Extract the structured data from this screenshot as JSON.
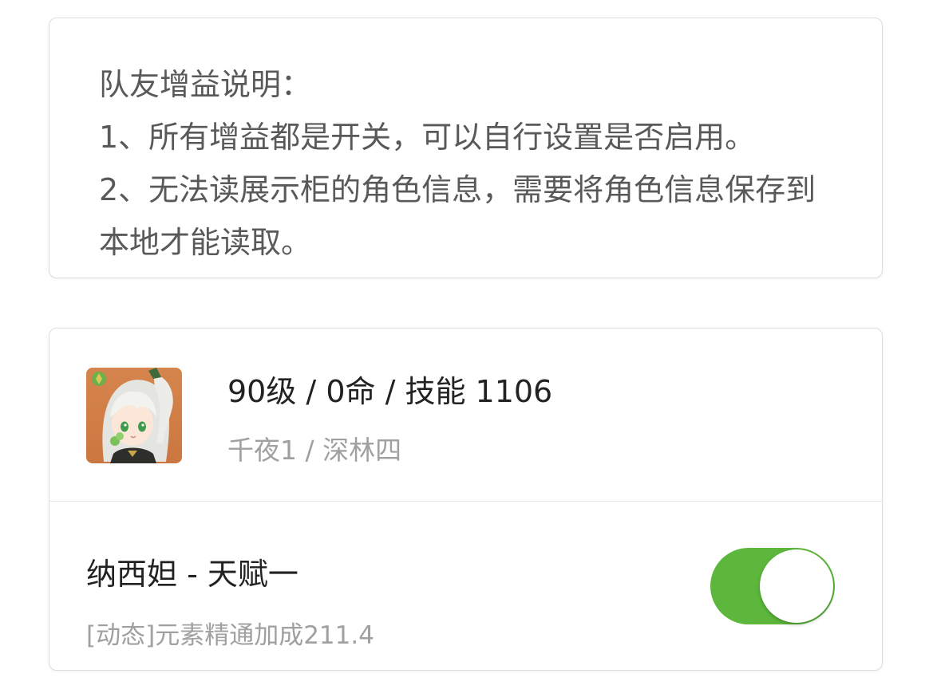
{
  "info": {
    "lines": [
      "队友增益说明：",
      "1、所有增益都是开关，可以自行设置是否启用。",
      "2、无法读展示柜的角色信息，需要将角色信息保存到本地才能读取。"
    ]
  },
  "character": {
    "avatar_icon": "nahida-avatar",
    "main": "90级 / 0命 / 技能 1106",
    "sub": "千夜1 / 深林四"
  },
  "buff": {
    "title": "纳西妲 - 天赋一",
    "desc": "[动态]元素精通加成211.4",
    "enabled": true,
    "toggle_color": "#5cb73c"
  }
}
